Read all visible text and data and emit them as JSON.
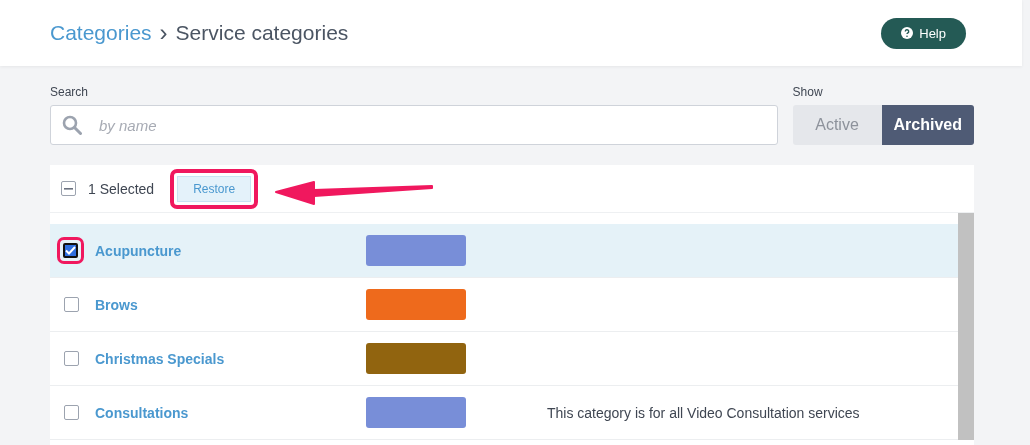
{
  "breadcrumb": {
    "parent": "Categories",
    "separator": "›",
    "current": "Service categories"
  },
  "help_button": {
    "label": "Help"
  },
  "search": {
    "label": "Search",
    "placeholder": "by name"
  },
  "show": {
    "label": "Show",
    "options": [
      {
        "label": "Active",
        "selected": false
      },
      {
        "label": "Archived",
        "selected": true
      }
    ]
  },
  "toolbar": {
    "select_all_indeterminate": true,
    "selected_count": "1 Selected",
    "restore_button": "Restore",
    "restore_highlighted": true
  },
  "rows": [
    {
      "name": "Acupuncture",
      "color": "#788ed8",
      "selected": true,
      "highlighted": true
    },
    {
      "name": "Brows",
      "color": "#ee6a1c",
      "selected": false,
      "highlighted": false
    },
    {
      "name": "Christmas Specials",
      "color": "#91640f",
      "selected": false,
      "highlighted": false
    },
    {
      "name": "Consultations",
      "color": "#788ed8",
      "description": "This category is for all Video Consultation services",
      "selected": false,
      "highlighted": false
    }
  ]
}
